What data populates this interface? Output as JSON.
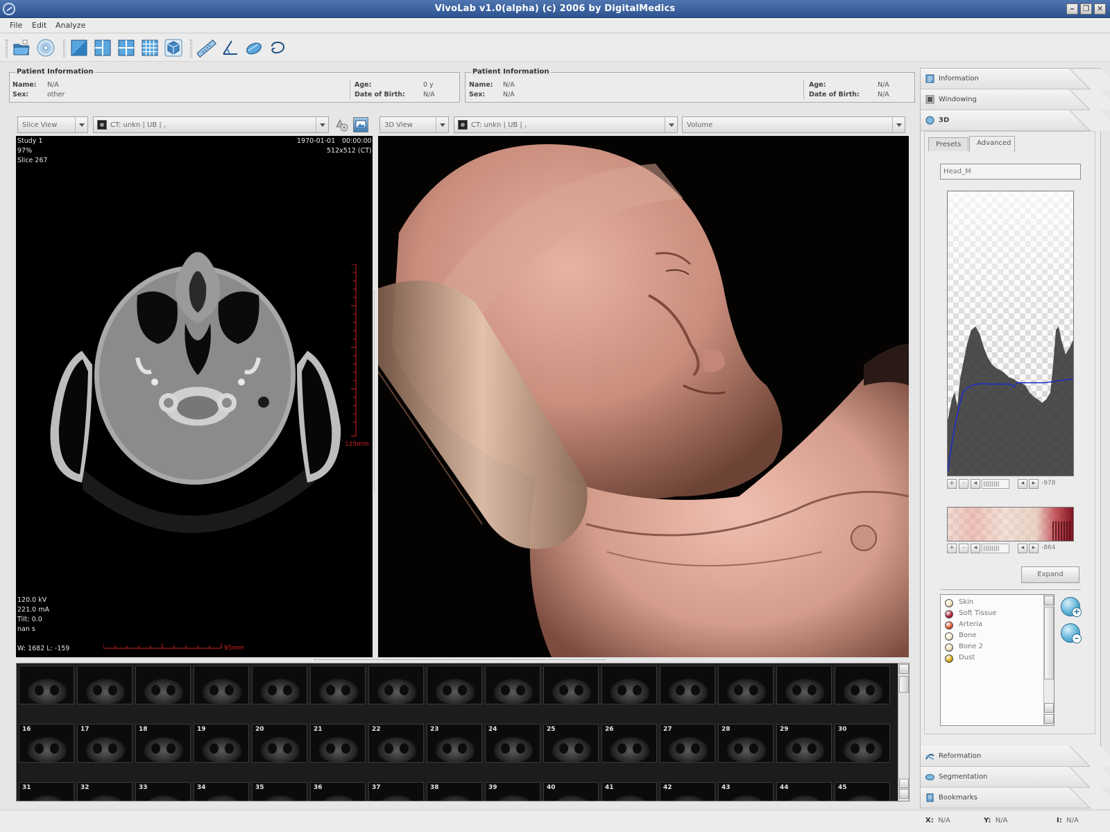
{
  "window": {
    "title": "VivoLab v1.0(alpha)       (c) 2006 by DigitalMedics"
  },
  "menu": [
    "File",
    "Edit",
    "Analyze"
  ],
  "toolbar": {
    "icons": [
      "open-folder-icon",
      "cd-icon",
      "layout-single-icon",
      "layout-split-icon",
      "layout-quad-icon",
      "layout-grid-icon",
      "3d-cube-icon",
      "ruler-icon",
      "angle-icon",
      "region-icon",
      "lasso-icon"
    ]
  },
  "patient_left": {
    "legend": "Patient Information",
    "name_label": "Name:",
    "name": "N/A",
    "sex_label": "Sex:",
    "sex": "other",
    "age_label": "Age:",
    "age": "0 y",
    "dob_label": "Date of Birth:",
    "dob": "N/A"
  },
  "patient_right": {
    "legend": "Patient Information",
    "name_label": "Name:",
    "name": "N/A",
    "sex_label": "Sex:",
    "sex": "N/A",
    "age_label": "Age:",
    "age": "N/A",
    "dob_label": "Date of Birth:",
    "dob": "N/A"
  },
  "slice_view": {
    "mode": "Slice View",
    "series": "CT: unkn | UB | ,",
    "study": "Study 1",
    "zoom": "97%",
    "slice": "Slice 267",
    "date": "1970-01-01",
    "time": "00:00:00",
    "dims": "512x512 (CT)",
    "kv": "120.0 kV",
    "ma": "221.0 mA",
    "tilt": "Tilt: 0.0",
    "exposure": "nan s",
    "window": "W: 1682  L: -159",
    "vruler": "125mm",
    "hruler": "95mm"
  },
  "view3d": {
    "mode": "3D View",
    "series": "CT: unkn | UB | ,",
    "render": "Volume"
  },
  "thumbnails": {
    "rows": [
      [
        "",
        "",
        "",
        "",
        "",
        "",
        "",
        "",
        "",
        "",
        "",
        "",
        "",
        "",
        ""
      ],
      [
        "16",
        "17",
        "18",
        "19",
        "20",
        "21",
        "22",
        "23",
        "24",
        "25",
        "26",
        "27",
        "28",
        "29",
        "30"
      ],
      [
        "31",
        "32",
        "33",
        "34",
        "35",
        "36",
        "37",
        "38",
        "39",
        "40",
        "41",
        "42",
        "43",
        "44",
        "45"
      ]
    ]
  },
  "right_panel": {
    "tabs_top": [
      "Information",
      "Windowing",
      "3D"
    ],
    "tabs_bottom": [
      "Reformation",
      "Segmentation",
      "Bookmarks"
    ],
    "subtabs": [
      "Presets",
      "Advanced"
    ],
    "active_subtab": "Advanced",
    "preset_name": "Head_M",
    "histogram_value": "-978",
    "colormap_value": "-864",
    "expand_label": "Expand",
    "tissues": [
      {
        "name": "Skin",
        "color": "#f1e2b4"
      },
      {
        "name": "Soft Tissue",
        "color": "#b0102a"
      },
      {
        "name": "Arteria",
        "color": "#e2502a"
      },
      {
        "name": "Bone",
        "color": "#efe7c8"
      },
      {
        "name": "Bone 2",
        "color": "#e9dcb0"
      },
      {
        "name": "Dust",
        "color": "#d9a900"
      }
    ]
  },
  "status": {
    "x_label": "X:",
    "x": "N/A",
    "y_label": "Y:",
    "y": "N/A",
    "i_label": "I:",
    "i": "N/A"
  }
}
